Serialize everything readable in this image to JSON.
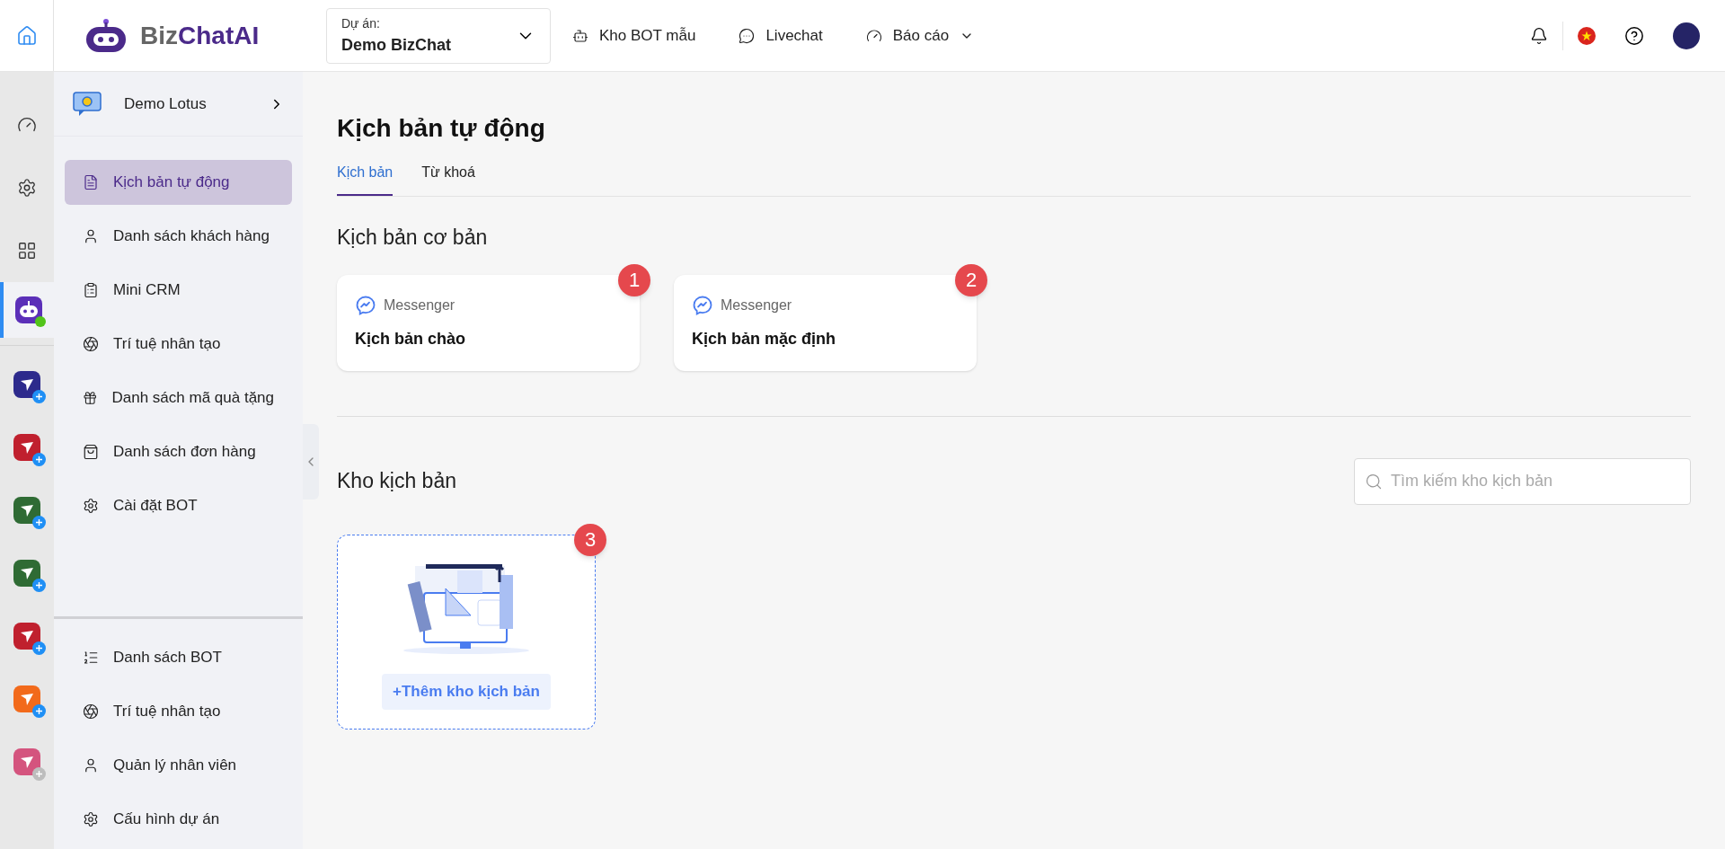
{
  "top_bar": {
    "logo": [
      "Biz",
      "ChatAI"
    ],
    "project": {
      "label": "Dự án:",
      "value": "Demo BizChat"
    },
    "nav": [
      {
        "label": "Kho BOT mẫu",
        "dropdown": false
      },
      {
        "label": "Livechat",
        "dropdown": false
      },
      {
        "label": "Báo cáo",
        "dropdown": true
      }
    ]
  },
  "rail": {
    "items": [
      {
        "selected": false
      },
      {
        "selected": false
      },
      {
        "selected": false
      },
      {
        "selected": true,
        "online": true
      }
    ],
    "apps": [
      {
        "color": "#2d2a8c",
        "active": true
      },
      {
        "color": "#c0202e",
        "active": true
      },
      {
        "color": "#2f6b34",
        "active": true
      },
      {
        "color": "#2f6b34",
        "active": true
      },
      {
        "color": "#c0202e",
        "active": true
      },
      {
        "color": "#f26a1b",
        "active": true
      },
      {
        "color": "#d4547e",
        "active": false
      }
    ]
  },
  "sidebar": {
    "header": "Demo Lotus",
    "items": [
      {
        "label": "Kịch bản tự động",
        "selected": true
      },
      {
        "label": "Danh sách khách hàng",
        "selected": false
      },
      {
        "label": "Mini CRM",
        "selected": false
      },
      {
        "label": "Trí tuệ nhân tạo",
        "selected": false
      },
      {
        "label": "Danh sách mã quà tặng",
        "selected": false
      },
      {
        "label": "Danh sách đơn hàng",
        "selected": false
      },
      {
        "label": "Cài đặt BOT",
        "selected": false
      }
    ],
    "bottom_items": [
      {
        "label": "Danh sách BOT",
        "selected": false
      },
      {
        "label": "Trí tuệ nhân tạo",
        "selected": false
      },
      {
        "label": "Quản lý nhân viên",
        "selected": false
      },
      {
        "label": "Cấu hình dự án",
        "selected": false
      }
    ]
  },
  "page": {
    "title": "Kịch bản tự động",
    "tabs": [
      {
        "label": "Kịch bản",
        "selected": true
      },
      {
        "label": "Từ khoá",
        "selected": false
      }
    ],
    "basic": {
      "title": "Kịch bản cơ bản",
      "cards": [
        {
          "channel": "Messenger",
          "title": "Kịch bản chào",
          "badge": "1"
        },
        {
          "channel": "Messenger",
          "title": "Kịch bản mặc định",
          "badge": "2"
        }
      ]
    },
    "library": {
      "title": "Kho kịch bản",
      "search": {
        "placeholder": "Tìm kiếm kho kịch bản"
      },
      "add_button": "+Thêm kho kịch bản",
      "badge": "3"
    }
  }
}
